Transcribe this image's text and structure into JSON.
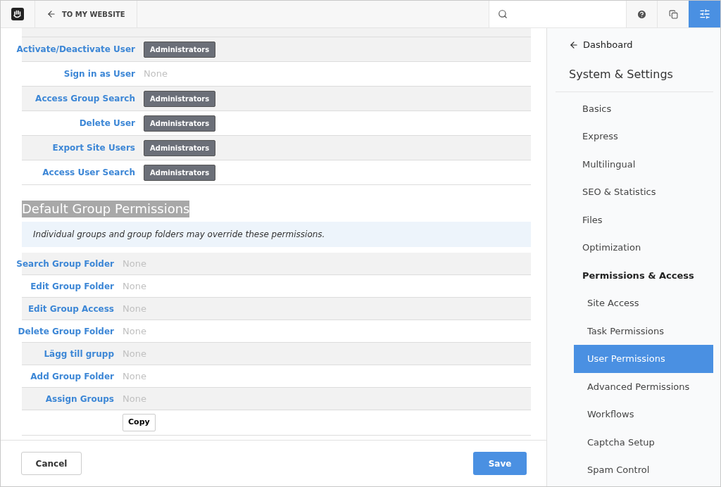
{
  "header": {
    "back_link": "TO MY WEBSITE"
  },
  "user_permissions": [
    {
      "label": "Activate/Deactivate User",
      "value": "Administrators",
      "kind": "badge"
    },
    {
      "label": "Sign in as User",
      "value": "None",
      "kind": "none"
    },
    {
      "label": "Access Group Search",
      "value": "Administrators",
      "kind": "badge"
    },
    {
      "label": "Delete User",
      "value": "Administrators",
      "kind": "badge"
    },
    {
      "label": "Export Site Users",
      "value": "Administrators",
      "kind": "badge"
    },
    {
      "label": "Access User Search",
      "value": "Administrators",
      "kind": "badge"
    }
  ],
  "group_section": {
    "heading": "Default Group Permissions",
    "heading_selected": true,
    "note": "Individual groups and group folders may override these permissions.",
    "rows": [
      {
        "label": "Search Group Folder",
        "value": "None",
        "kind": "none"
      },
      {
        "label": "Edit Group Folder",
        "value": "None",
        "kind": "none"
      },
      {
        "label": "Edit Group Access",
        "value": "None",
        "kind": "none"
      },
      {
        "label": "Delete Group Folder",
        "value": "None",
        "kind": "none"
      },
      {
        "label": "Lägg till grupp",
        "value": "None",
        "kind": "none"
      },
      {
        "label": "Add Group Folder",
        "value": "None",
        "kind": "none"
      },
      {
        "label": "Assign Groups",
        "value": "None",
        "kind": "none"
      }
    ],
    "copy_button": "Copy"
  },
  "footer": {
    "cancel": "Cancel",
    "save": "Save"
  },
  "sidebar": {
    "back": "Dashboard",
    "title": "System & Settings",
    "items": [
      {
        "label": "Basics",
        "selected": false
      },
      {
        "label": "Express",
        "selected": false
      },
      {
        "label": "Multilingual",
        "selected": false
      },
      {
        "label": "SEO & Statistics",
        "selected": false
      },
      {
        "label": "Files",
        "selected": false
      },
      {
        "label": "Optimization",
        "selected": false
      },
      {
        "label": "Permissions & Access",
        "selected": false,
        "expanded": true,
        "children": [
          {
            "label": "Site Access",
            "selected": false
          },
          {
            "label": "Task Permissions",
            "selected": false
          },
          {
            "label": "User Permissions",
            "selected": true
          },
          {
            "label": "Advanced Permissions",
            "selected": false
          },
          {
            "label": "Workflows",
            "selected": false
          },
          {
            "label": "Captcha Setup",
            "selected": false
          },
          {
            "label": "Spam Control",
            "selected": false
          }
        ]
      }
    ]
  }
}
